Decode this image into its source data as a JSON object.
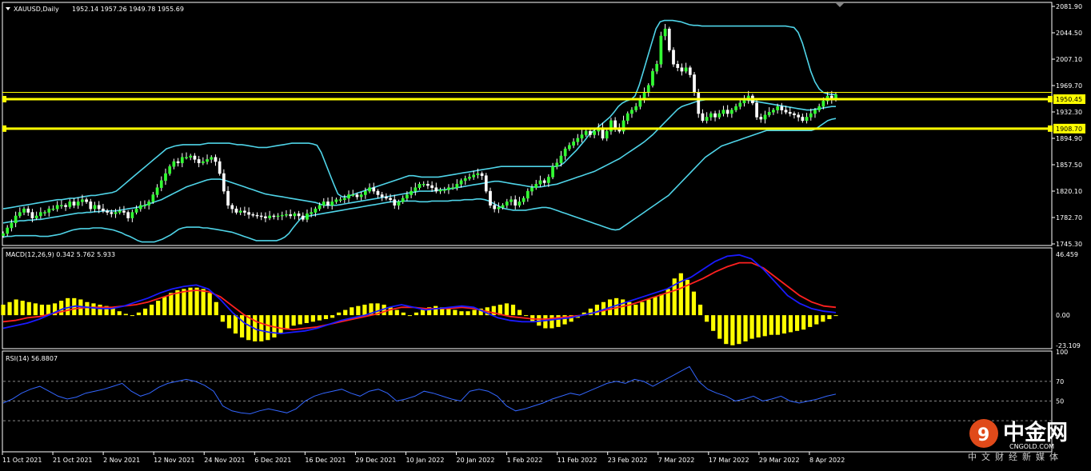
{
  "chart_data": {
    "type": "candlestick",
    "symbol_header": "XAUUSD,Daily",
    "ohlc_header": "1952.14 1957.26 1949.78 1955.69",
    "price_axis": {
      "ticks": [
        "2081.90",
        "2044.50",
        "2007.10",
        "1969.70",
        "1932.30",
        "1894.90",
        "1857.50",
        "1820.10",
        "1782.70",
        "1745.30"
      ],
      "ylim": [
        1745.3,
        2081.9
      ]
    },
    "horizontal_levels": [
      {
        "value": 1950.45,
        "label": "1950.45",
        "color": "#ffff00"
      },
      {
        "value": 1908.7,
        "label": "1908.70",
        "color": "#ffff00"
      }
    ],
    "date_ticks": [
      "11 Oct 2021",
      "21 Oct 2021",
      "2 Nov 2021",
      "12 Nov 2021",
      "24 Nov 2021",
      "6 Dec 2021",
      "16 Dec 2021",
      "29 Dec 2021",
      "10 Jan 2022",
      "20 Jan 2022",
      "1 Feb 2022",
      "11 Feb 2022",
      "23 Feb 2022",
      "7 Mar 2022",
      "17 Mar 2022",
      "29 Mar 2022",
      "8 Apr 2022"
    ],
    "closes": [
      1760,
      1768,
      1775,
      1785,
      1790,
      1795,
      1790,
      1782,
      1785,
      1790,
      1790,
      1795,
      1795,
      1800,
      1800,
      1798,
      1805,
      1800,
      1805,
      1808,
      1805,
      1795,
      1800,
      1795,
      1792,
      1790,
      1788,
      1790,
      1792,
      1790,
      1782,
      1790,
      1795,
      1800,
      1800,
      1805,
      1815,
      1825,
      1835,
      1845,
      1855,
      1862,
      1860,
      1868,
      1868,
      1870,
      1865,
      1860,
      1862,
      1865,
      1868,
      1862,
      1845,
      1820,
      1800,
      1795,
      1790,
      1792,
      1790,
      1787,
      1786,
      1785,
      1784,
      1782,
      1785,
      1784,
      1785,
      1786,
      1787,
      1785,
      1788,
      1785,
      1780,
      1788,
      1790,
      1795,
      1800,
      1805,
      1800,
      1805,
      1808,
      1808,
      1810,
      1815,
      1815,
      1812,
      1815,
      1820,
      1825,
      1820,
      1815,
      1812,
      1810,
      1808,
      1800,
      1805,
      1810,
      1815,
      1820,
      1825,
      1830,
      1830,
      1828,
      1825,
      1820,
      1822,
      1822,
      1825,
      1825,
      1830,
      1835,
      1838,
      1840,
      1843,
      1845,
      1842,
      1820,
      1800,
      1795,
      1797,
      1800,
      1805,
      1808,
      1800,
      1805,
      1810,
      1820,
      1825,
      1830,
      1835,
      1832,
      1840,
      1855,
      1860,
      1870,
      1880,
      1885,
      1890,
      1895,
      1900,
      1905,
      1900,
      1905,
      1910,
      1895,
      1905,
      1920,
      1910,
      1905,
      1920,
      1930,
      1935,
      1940,
      1950,
      1960,
      1970,
      1990,
      2000,
      2040,
      2050,
      2020,
      2000,
      1995,
      1990,
      1995,
      1985,
      1960,
      1930,
      1920,
      1925,
      1930,
      1925,
      1930,
      1935,
      1930,
      1935,
      1940,
      1945,
      1950,
      1955,
      1945,
      1925,
      1922,
      1928,
      1932,
      1935,
      1940,
      1935,
      1932,
      1930,
      1928,
      1925,
      1920,
      1925,
      1930,
      1935,
      1940,
      1948,
      1955,
      1950,
      1957
    ],
    "upper_band": [
      1795,
      1796,
      1797,
      1798,
      1799,
      1800,
      1801,
      1802,
      1803,
      1804,
      1805,
      1806,
      1807,
      1808,
      1808,
      1809,
      1810,
      1810,
      1811,
      1812,
      1813,
      1814,
      1814,
      1815,
      1816,
      1817,
      1818,
      1820,
      1825,
      1830,
      1835,
      1840,
      1845,
      1850,
      1855,
      1860,
      1865,
      1870,
      1875,
      1880,
      1882,
      1884,
      1885,
      1886,
      1886,
      1886,
      1886,
      1886,
      1887,
      1888,
      1888,
      1888,
      1888,
      1888,
      1888,
      1887,
      1886,
      1886,
      1885,
      1884,
      1883,
      1882,
      1882,
      1882,
      1883,
      1884,
      1885,
      1886,
      1887,
      1888,
      1888,
      1888,
      1888,
      1888,
      1887,
      1885,
      1875,
      1860,
      1845,
      1830,
      1816,
      1812,
      1812,
      1814,
      1816,
      1818,
      1820,
      1822,
      1824,
      1826,
      1828,
      1830,
      1832,
      1834,
      1836,
      1838,
      1840,
      1842,
      1842,
      1841,
      1840,
      1840,
      1840,
      1840,
      1840,
      1841,
      1842,
      1843,
      1844,
      1845,
      1846,
      1847,
      1848,
      1849,
      1850,
      1851,
      1852,
      1853,
      1854,
      1855,
      1855,
      1855,
      1855,
      1855,
      1855,
      1855,
      1855,
      1855,
      1855,
      1855,
      1855,
      1855,
      1855,
      1856,
      1860,
      1866,
      1872,
      1878,
      1885,
      1892,
      1900,
      1905,
      1910,
      1915,
      1920,
      1925,
      1932,
      1940,
      1945,
      1948,
      1950,
      1955,
      1970,
      1990,
      2010,
      2030,
      2050,
      2060,
      2062,
      2062,
      2062,
      2061,
      2060,
      2058,
      2056,
      2055,
      2055,
      2054,
      2054,
      2054,
      2054,
      2054,
      2054,
      2054,
      2054,
      2054,
      2054,
      2054,
      2054,
      2054,
      2054,
      2054,
      2054,
      2054,
      2054,
      2054,
      2054,
      2054,
      2053,
      2052,
      2045,
      2030,
      2010,
      1990,
      1975,
      1965,
      1960,
      1958,
      1957,
      1957
    ],
    "middle_band": [
      1775,
      1776,
      1777,
      1777,
      1778,
      1778,
      1779,
      1779,
      1780,
      1780,
      1781,
      1782,
      1783,
      1784,
      1785,
      1786,
      1787,
      1788,
      1789,
      1789,
      1790,
      1790,
      1791,
      1791,
      1792,
      1792,
      1792,
      1792,
      1793,
      1794,
      1795,
      1796,
      1797,
      1798,
      1800,
      1802,
      1804,
      1806,
      1808,
      1811,
      1814,
      1817,
      1820,
      1823,
      1826,
      1828,
      1830,
      1832,
      1834,
      1836,
      1837,
      1837,
      1837,
      1836,
      1834,
      1832,
      1830,
      1828,
      1826,
      1824,
      1822,
      1820,
      1818,
      1816,
      1815,
      1814,
      1813,
      1812,
      1811,
      1810,
      1809,
      1808,
      1807,
      1806,
      1805,
      1804,
      1802,
      1800,
      1800,
      1800,
      1800,
      1801,
      1802,
      1803,
      1804,
      1805,
      1806,
      1807,
      1808,
      1809,
      1810,
      1811,
      1812,
      1813,
      1814,
      1815,
      1816,
      1817,
      1818,
      1819,
      1820,
      1820,
      1820,
      1820,
      1821,
      1822,
      1822,
      1823,
      1824,
      1825,
      1826,
      1827,
      1828,
      1829,
      1830,
      1831,
      1832,
      1833,
      1834,
      1834,
      1833,
      1832,
      1831,
      1830,
      1829,
      1828,
      1827,
      1826,
      1826,
      1826,
      1827,
      1828,
      1829,
      1830,
      1832,
      1834,
      1836,
      1838,
      1840,
      1842,
      1844,
      1846,
      1848,
      1851,
      1854,
      1857,
      1860,
      1863,
      1866,
      1870,
      1874,
      1878,
      1882,
      1886,
      1890,
      1895,
      1900,
      1906,
      1912,
      1918,
      1924,
      1930,
      1936,
      1940,
      1942,
      1944,
      1946,
      1948,
      1949,
      1950,
      1950,
      1950,
      1950,
      1950,
      1950,
      1950,
      1950,
      1950,
      1950,
      1949,
      1948,
      1947,
      1946,
      1945,
      1944,
      1943,
      1942,
      1941,
      1940,
      1939,
      1938,
      1937,
      1936,
      1935,
      1935,
      1936,
      1937,
      1938,
      1939,
      1940,
      1940
    ],
    "lower_band": [
      1755,
      1756,
      1756,
      1757,
      1757,
      1757,
      1757,
      1757,
      1757,
      1756,
      1756,
      1756,
      1757,
      1758,
      1759,
      1761,
      1763,
      1765,
      1766,
      1767,
      1767,
      1767,
      1768,
      1768,
      1768,
      1767,
      1766,
      1765,
      1763,
      1761,
      1758,
      1756,
      1753,
      1750,
      1748,
      1748,
      1748,
      1748,
      1750,
      1752,
      1755,
      1758,
      1762,
      1766,
      1768,
      1769,
      1769,
      1769,
      1769,
      1768,
      1768,
      1767,
      1766,
      1765,
      1764,
      1763,
      1762,
      1760,
      1758,
      1756,
      1754,
      1752,
      1750,
      1750,
      1750,
      1750,
      1750,
      1750,
      1752,
      1755,
      1760,
      1768,
      1775,
      1782,
      1784,
      1785,
      1786,
      1787,
      1788,
      1789,
      1790,
      1791,
      1792,
      1793,
      1794,
      1795,
      1796,
      1797,
      1798,
      1799,
      1800,
      1801,
      1802,
      1803,
      1804,
      1805,
      1805,
      1805,
      1806,
      1806,
      1806,
      1806,
      1805,
      1805,
      1805,
      1806,
      1806,
      1806,
      1806,
      1806,
      1807,
      1807,
      1807,
      1808,
      1808,
      1808,
      1809,
      1809,
      1808,
      1806,
      1803,
      1800,
      1797,
      1795,
      1794,
      1793,
      1793,
      1793,
      1793,
      1794,
      1795,
      1796,
      1797,
      1797,
      1796,
      1794,
      1792,
      1790,
      1788,
      1786,
      1784,
      1782,
      1780,
      1778,
      1776,
      1774,
      1772,
      1770,
      1768,
      1766,
      1765,
      1766,
      1770,
      1774,
      1778,
      1782,
      1786,
      1790,
      1794,
      1798,
      1802,
      1806,
      1810,
      1814,
      1820,
      1826,
      1832,
      1838,
      1844,
      1850,
      1856,
      1862,
      1868,
      1872,
      1876,
      1880,
      1884,
      1886,
      1888,
      1890,
      1892,
      1894,
      1896,
      1898,
      1900,
      1902,
      1904,
      1906,
      1906,
      1906,
      1906,
      1906,
      1906,
      1906,
      1906,
      1906,
      1906,
      1906,
      1906,
      1908,
      1912,
      1916,
      1920,
      1922,
      1923
    ],
    "macd": {
      "label": "MACD(12,26,9) 0.342 5.762 5.933",
      "ticks": [
        "46.459",
        "0.00",
        "-23.109"
      ],
      "ylim": [
        -23.109,
        46.459
      ],
      "histogram": [
        8,
        10,
        12,
        11,
        10,
        9,
        8,
        8,
        9,
        11,
        13,
        13,
        12,
        10,
        9,
        8,
        7,
        5,
        3,
        1,
        0,
        2,
        5,
        8,
        11,
        14,
        17,
        19,
        20,
        21,
        21,
        20,
        17,
        10,
        -5,
        -10,
        -14,
        -17,
        -19,
        -20,
        -20,
        -19,
        -17,
        -14,
        -11,
        -8,
        -7,
        -6,
        -5,
        -4,
        -3,
        -2,
        2,
        4,
        6,
        7,
        8,
        9,
        9,
        8,
        6,
        4,
        2,
        0,
        2,
        4,
        6,
        7,
        6,
        5,
        4,
        3,
        3,
        4,
        5,
        6,
        7,
        8,
        9,
        8,
        4,
        0,
        -5,
        -8,
        -10,
        -10,
        -9,
        -7,
        -5,
        -2,
        2,
        5,
        8,
        10,
        12,
        13,
        12,
        10,
        8,
        10,
        12,
        14,
        16,
        20,
        28,
        32,
        27,
        18,
        8,
        -5,
        -12,
        -18,
        -22,
        -23,
        -22,
        -20,
        -18,
        -17,
        -16,
        -15,
        -15,
        -14,
        -13,
        -12,
        -11,
        -9,
        -7,
        -5,
        -3,
        0
      ],
      "macd_line": [
        -10,
        -8,
        -6,
        -3,
        1,
        5,
        7,
        6,
        5,
        5,
        7,
        10,
        13,
        17,
        20,
        22,
        23,
        20,
        12,
        2,
        -6,
        -11,
        -13,
        -14,
        -13,
        -12,
        -10,
        -7,
        -4,
        -2,
        0,
        3,
        6,
        8,
        6,
        4,
        5,
        6,
        7,
        6,
        2,
        -2,
        -4,
        -5,
        -5,
        -4,
        -3,
        -2,
        0,
        2,
        5,
        8,
        11,
        14,
        17,
        20,
        25,
        29,
        35,
        41,
        45,
        46,
        43,
        35,
        25,
        15,
        9,
        5,
        3,
        2
      ],
      "signal_line": [
        -5,
        -4,
        -2,
        -1,
        1,
        3,
        5,
        6,
        6,
        6,
        7,
        8,
        10,
        13,
        16,
        18,
        19,
        18,
        14,
        7,
        0,
        -5,
        -8,
        -10,
        -11,
        -10,
        -9,
        -7,
        -5,
        -3,
        -1,
        1,
        4,
        6,
        6,
        5,
        5,
        5,
        6,
        5,
        3,
        1,
        -1,
        -2,
        -3,
        -3,
        -2,
        -1,
        0,
        2,
        4,
        6,
        8,
        11,
        14,
        17,
        20,
        24,
        28,
        33,
        37,
        40,
        40,
        36,
        29,
        22,
        15,
        10,
        7,
        6
      ]
    },
    "rsi": {
      "label": "RSI(14) 56.8807",
      "ticks": [
        "100",
        "70",
        "50"
      ],
      "levels": [
        70,
        50,
        30
      ],
      "ylim": [
        0,
        100
      ],
      "values": [
        48,
        52,
        58,
        62,
        65,
        60,
        55,
        52,
        54,
        58,
        60,
        62,
        65,
        68,
        60,
        55,
        58,
        64,
        68,
        70,
        72,
        70,
        66,
        60,
        45,
        40,
        38,
        37,
        40,
        42,
        40,
        38,
        42,
        50,
        55,
        58,
        60,
        62,
        58,
        55,
        60,
        62,
        58,
        50,
        52,
        55,
        60,
        58,
        55,
        52,
        50,
        60,
        62,
        60,
        55,
        45,
        40,
        42,
        45,
        48,
        52,
        55,
        58,
        56,
        60,
        64,
        68,
        70,
        68,
        72,
        70,
        65,
        70,
        75,
        80,
        85,
        70,
        62,
        58,
        55,
        50,
        52,
        55,
        50,
        52,
        55,
        50,
        48,
        50,
        52,
        55,
        57
      ]
    }
  },
  "watermark": {
    "cn": "中金网",
    "en": "CNGOLD.COM",
    "sub": "中文财经新媒体"
  }
}
